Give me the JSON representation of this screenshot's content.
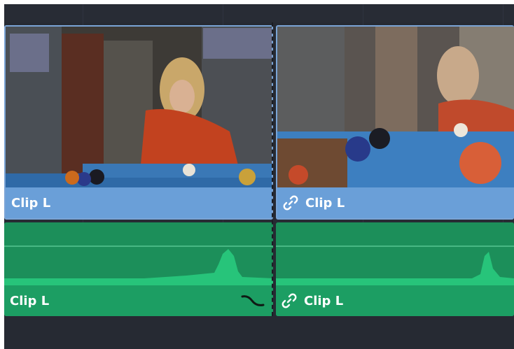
{
  "timeline": {
    "clips": [
      {
        "video_label": "Clip L",
        "audio_label": "Clip L",
        "linked": false
      },
      {
        "video_label": "Clip L",
        "audio_label": "Clip L",
        "linked": true
      }
    ]
  },
  "colors": {
    "background": "#262a33",
    "video_clip": "#6a9fd8",
    "audio_clip": "#1c9e63",
    "waveform": "#27c47a"
  },
  "icons": [
    "link-icon",
    "transition-curve-icon"
  ]
}
